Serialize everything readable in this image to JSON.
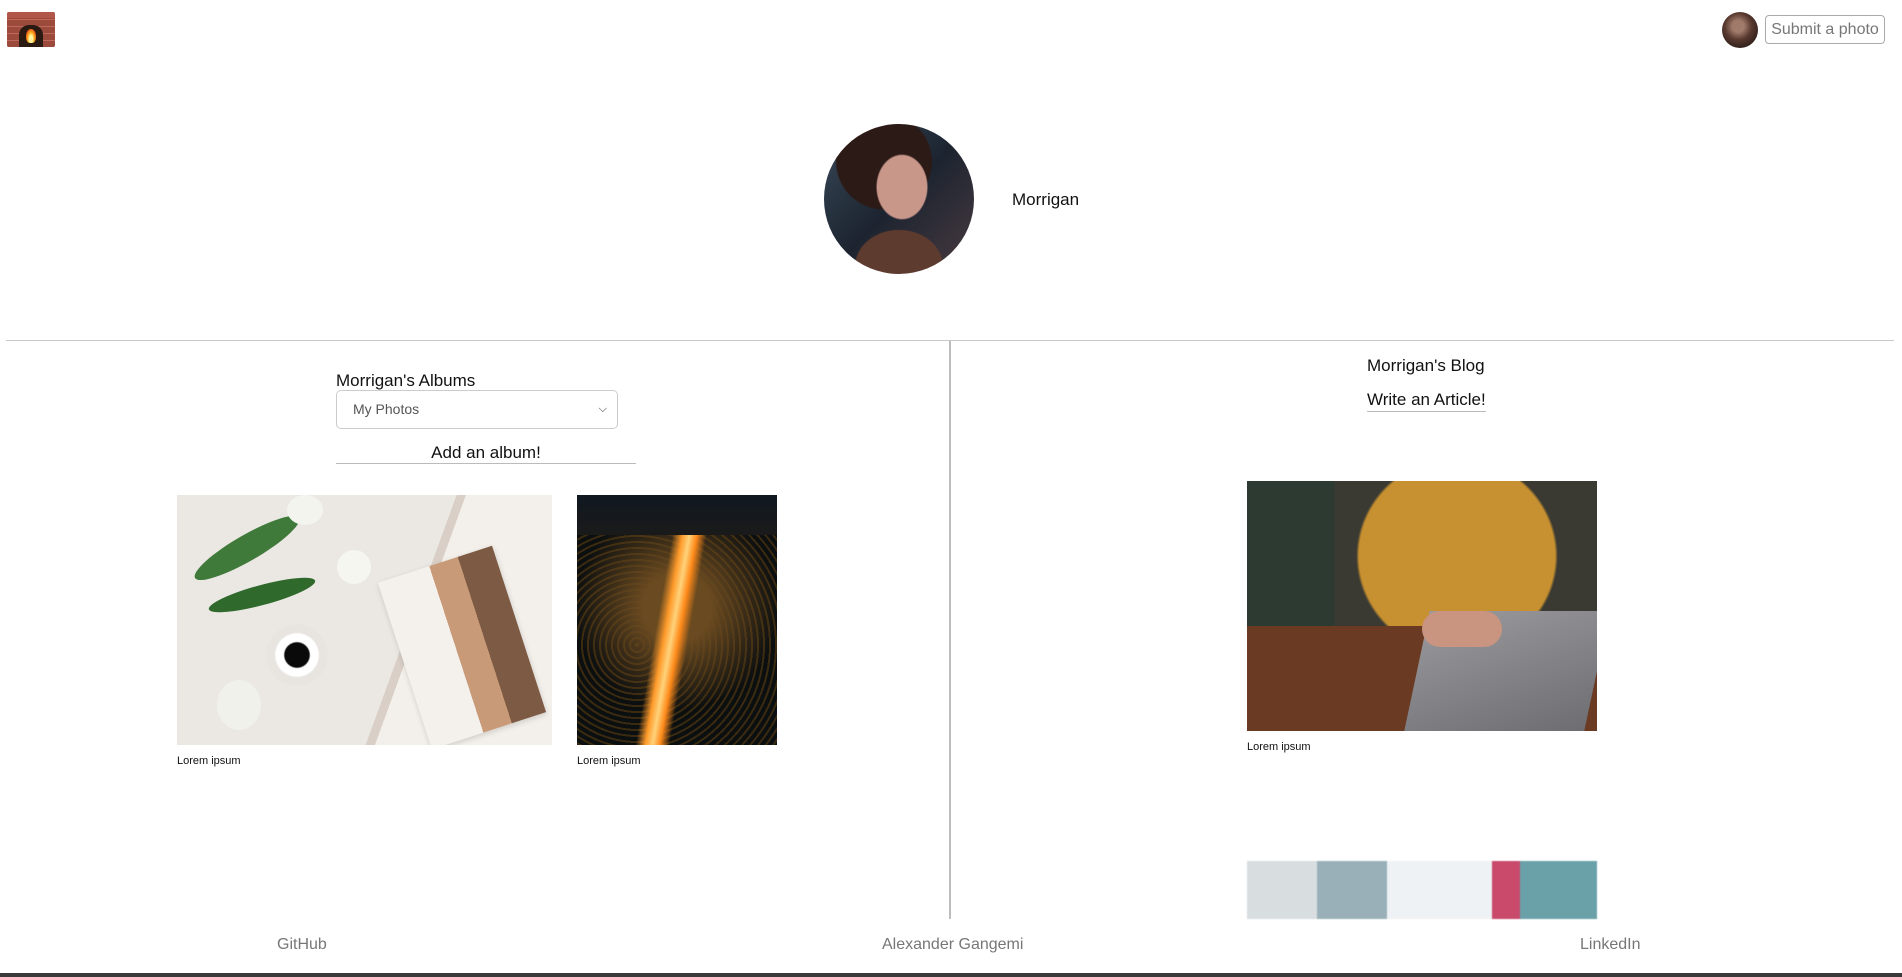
{
  "header": {
    "logo_icon": "fireplace-icon",
    "submit_label": "Submit a photo"
  },
  "profile": {
    "name": "Morrigan"
  },
  "albums": {
    "title": "Morrigan's Albums",
    "selected_album": "My Photos",
    "add_label": "Add an album!",
    "photos": [
      {
        "caption": "Lorem ipsum"
      },
      {
        "caption": "Lorem ipsum"
      }
    ]
  },
  "blog": {
    "title": "Morrigan's Blog",
    "write_label": "Write an Article!",
    "articles": [
      {
        "caption": "Lorem ipsum"
      }
    ]
  },
  "footer": {
    "github": "GitHub",
    "author": "Alexander Gangemi",
    "linkedin": "LinkedIn"
  }
}
